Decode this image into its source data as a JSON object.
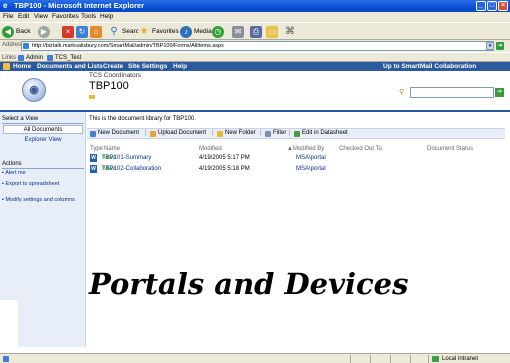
{
  "window": {
    "title": "TBP100 - Microsoft Internet Explorer",
    "min": "_",
    "max": "□",
    "close": "×"
  },
  "menu": [
    "File",
    "Edit",
    "View",
    "Favorites",
    "Tools",
    "Help"
  ],
  "toolbar": {
    "back": "Back",
    "search": "Search",
    "favorites": "Favorites",
    "media": "Media"
  },
  "address": {
    "label": "Address",
    "url": "http://biztalk.marksalisbury.com/SmartMail/admin/TBP100/Forms/AllItems.aspx",
    "go": "Go"
  },
  "links": {
    "label": "Links",
    "items": [
      "Admin",
      "TCS_Test"
    ]
  },
  "nav": {
    "items": [
      "Home",
      "Documents and Lists",
      "Create",
      "Site Settings",
      "Help"
    ],
    "up_link": "Up to SmartMail Collaboration"
  },
  "site": {
    "subtitle": "TCS Coordinators",
    "title": "TBP100"
  },
  "sidebar": {
    "select_view": "Select a View",
    "views": [
      "All Documents",
      "Explorer View"
    ],
    "actions_heading": "Actions",
    "actions": [
      "Alert me",
      "Export to spreadsheet",
      "Modify settings and columns"
    ]
  },
  "content": {
    "description": "This is the document library for TBP100.",
    "toolbar": [
      "New Document",
      "Upload Document",
      "New Folder",
      "Filter",
      "Edit in Datasheet"
    ],
    "columns": [
      "Type",
      "Name",
      "Modified",
      "Modified By",
      "Checked Out To",
      "Document Status"
    ],
    "rows": [
      {
        "name": "TBP101-Summary",
        "badge": "NEW",
        "modified": "4/19/2005 5:17 PM",
        "by": "MSA\\portal"
      },
      {
        "name": "TBP102-Collaboration",
        "badge": "NEW",
        "modified": "4/19/2005 5:18 PM",
        "by": "MSA\\portal"
      }
    ]
  },
  "overlay": "Portals and Devices",
  "status": {
    "zone": "Local intranet"
  },
  "colors": {
    "titlebar": "#0a4fd4",
    "navbar": "#2c5a9f",
    "sidebar": "#e8eef8"
  }
}
